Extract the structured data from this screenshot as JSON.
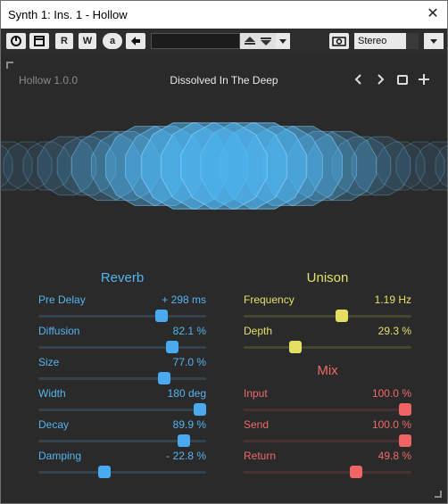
{
  "window": {
    "title": "Synth 1: Ins. 1 - Hollow",
    "close": "✕"
  },
  "toolbar": {
    "read": "R",
    "write": "W",
    "auto": "a",
    "stereo": "Stereo"
  },
  "plugin": {
    "version": "Hollow 1.0.0",
    "preset": "Dissolved In The Deep"
  },
  "reverb": {
    "title": "Reverb",
    "color": "#56b4ee",
    "params": [
      {
        "label": "Pre Delay",
        "value": "+ 298 ms",
        "level": 0.75
      },
      {
        "label": "Diffusion",
        "value": "82.1 %",
        "level": 0.821
      },
      {
        "label": "Size",
        "value": "77.0 %",
        "level": 0.77
      },
      {
        "label": "Width",
        "value": "180 deg",
        "level": 1.0
      },
      {
        "label": "Decay",
        "value": "89.9 %",
        "level": 0.899
      },
      {
        "label": "Damping",
        "value": "- 22.8 %",
        "level": 0.386
      }
    ]
  },
  "unison": {
    "title": "Unison",
    "color": "#e6e06a",
    "params": [
      {
        "label": "Frequency",
        "value": "1.19 Hz",
        "level": 0.59
      },
      {
        "label": "Depth",
        "value": "29.3 %",
        "level": 0.293
      }
    ]
  },
  "mix": {
    "title": "Mix",
    "color": "#ef6a6a",
    "params": [
      {
        "label": "Input",
        "value": "100.0 %",
        "level": 1.0
      },
      {
        "label": "Send",
        "value": "100.0 %",
        "level": 1.0
      },
      {
        "label": "Return",
        "value": "49.8 %",
        "level": 0.682
      }
    ]
  }
}
